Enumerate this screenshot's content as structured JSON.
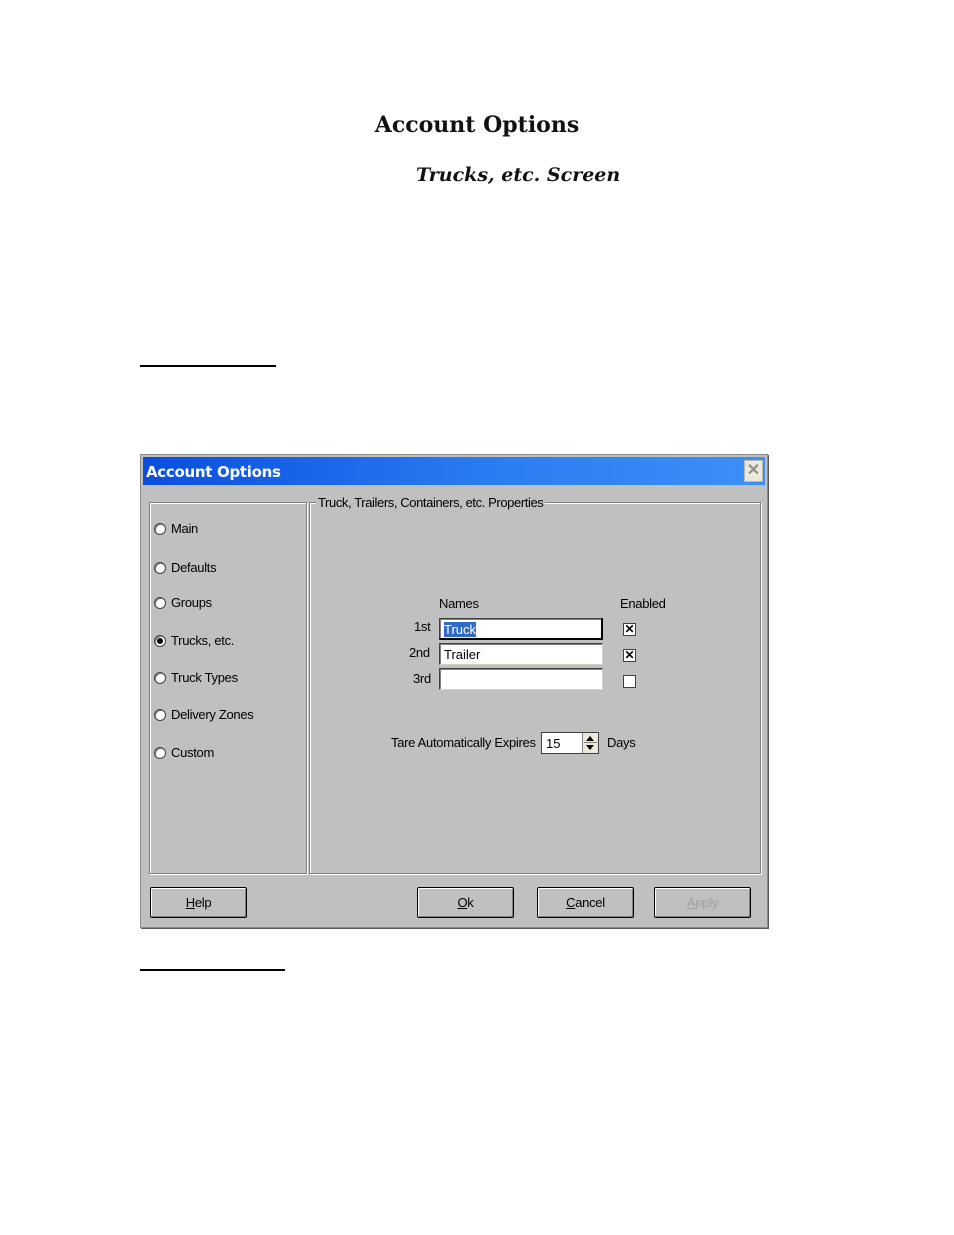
{
  "document": {
    "title": "Account Options",
    "subtitle": "Trucks, etc. Screen"
  },
  "dialog": {
    "title": "Account Options",
    "close_icon": "close-x-icon",
    "nav": {
      "items": [
        {
          "label": "Main",
          "selected": false
        },
        {
          "label": "Defaults",
          "selected": false
        },
        {
          "label": "Groups",
          "selected": false
        },
        {
          "label": "Trucks, etc.",
          "selected": true
        },
        {
          "label": "Truck Types",
          "selected": false
        },
        {
          "label": "Delivery Zones",
          "selected": false
        },
        {
          "label": "Custom",
          "selected": false
        }
      ]
    },
    "properties": {
      "group_label": "Truck, Trailers, Containers, etc. Properties",
      "names_header": "Names",
      "enabled_header": "Enabled",
      "rows": [
        {
          "label": "1st",
          "value": "Truck",
          "enabled": true,
          "check_glyph": "✕"
        },
        {
          "label": "2nd",
          "value": "Trailer",
          "enabled": true,
          "check_glyph": "✕"
        },
        {
          "label": "3rd",
          "value": "",
          "enabled": false,
          "check_glyph": ""
        }
      ],
      "tare_label": "Tare Automatically Expires",
      "tare_value": "15",
      "tare_unit": "Days"
    },
    "buttons": {
      "help": {
        "mnemonic": "H",
        "rest": "elp"
      },
      "ok": {
        "mnemonic": "O",
        "rest": "k"
      },
      "cancel": {
        "mnemonic": "C",
        "rest": "ancel"
      },
      "apply": {
        "mnemonic": "A",
        "rest": "pply",
        "disabled": true
      }
    }
  }
}
